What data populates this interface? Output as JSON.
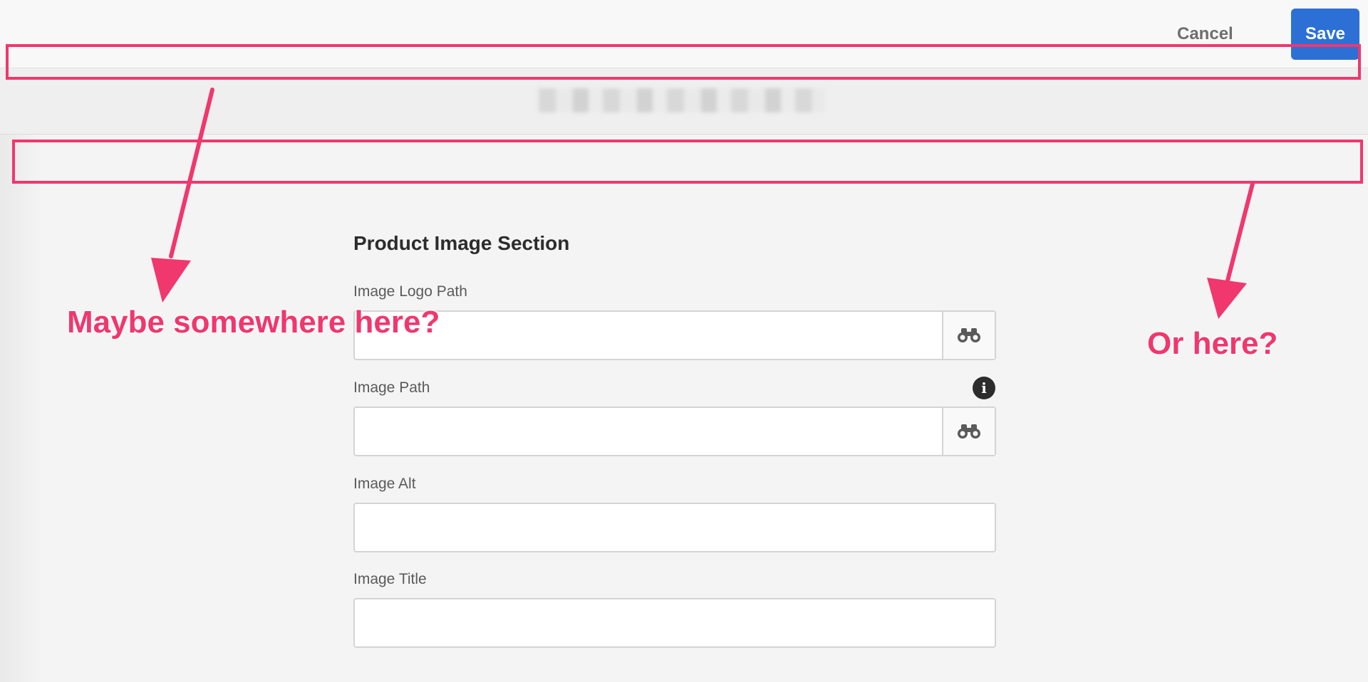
{
  "toolbar": {
    "cancel_label": "Cancel",
    "save_label": "Save",
    "save_color": "#2c70d6"
  },
  "title_bar": {
    "title_blurred": true
  },
  "form": {
    "section_title": "Product Image Section",
    "fields": [
      {
        "label": "Image Logo Path",
        "value": "",
        "has_picker": true,
        "picker_icon": "binoculars-icon"
      },
      {
        "label": "Image Path",
        "value": "",
        "has_picker": true,
        "picker_icon": "binoculars-icon",
        "has_info": true,
        "info_icon": "info-icon"
      },
      {
        "label": "Image Alt",
        "value": "",
        "has_picker": false
      },
      {
        "label": "Image Title",
        "value": "",
        "has_picker": false
      }
    ]
  },
  "annotations": {
    "color": "#f0376e",
    "left_text": "Maybe somewhere here?",
    "right_text": "Or here?"
  }
}
